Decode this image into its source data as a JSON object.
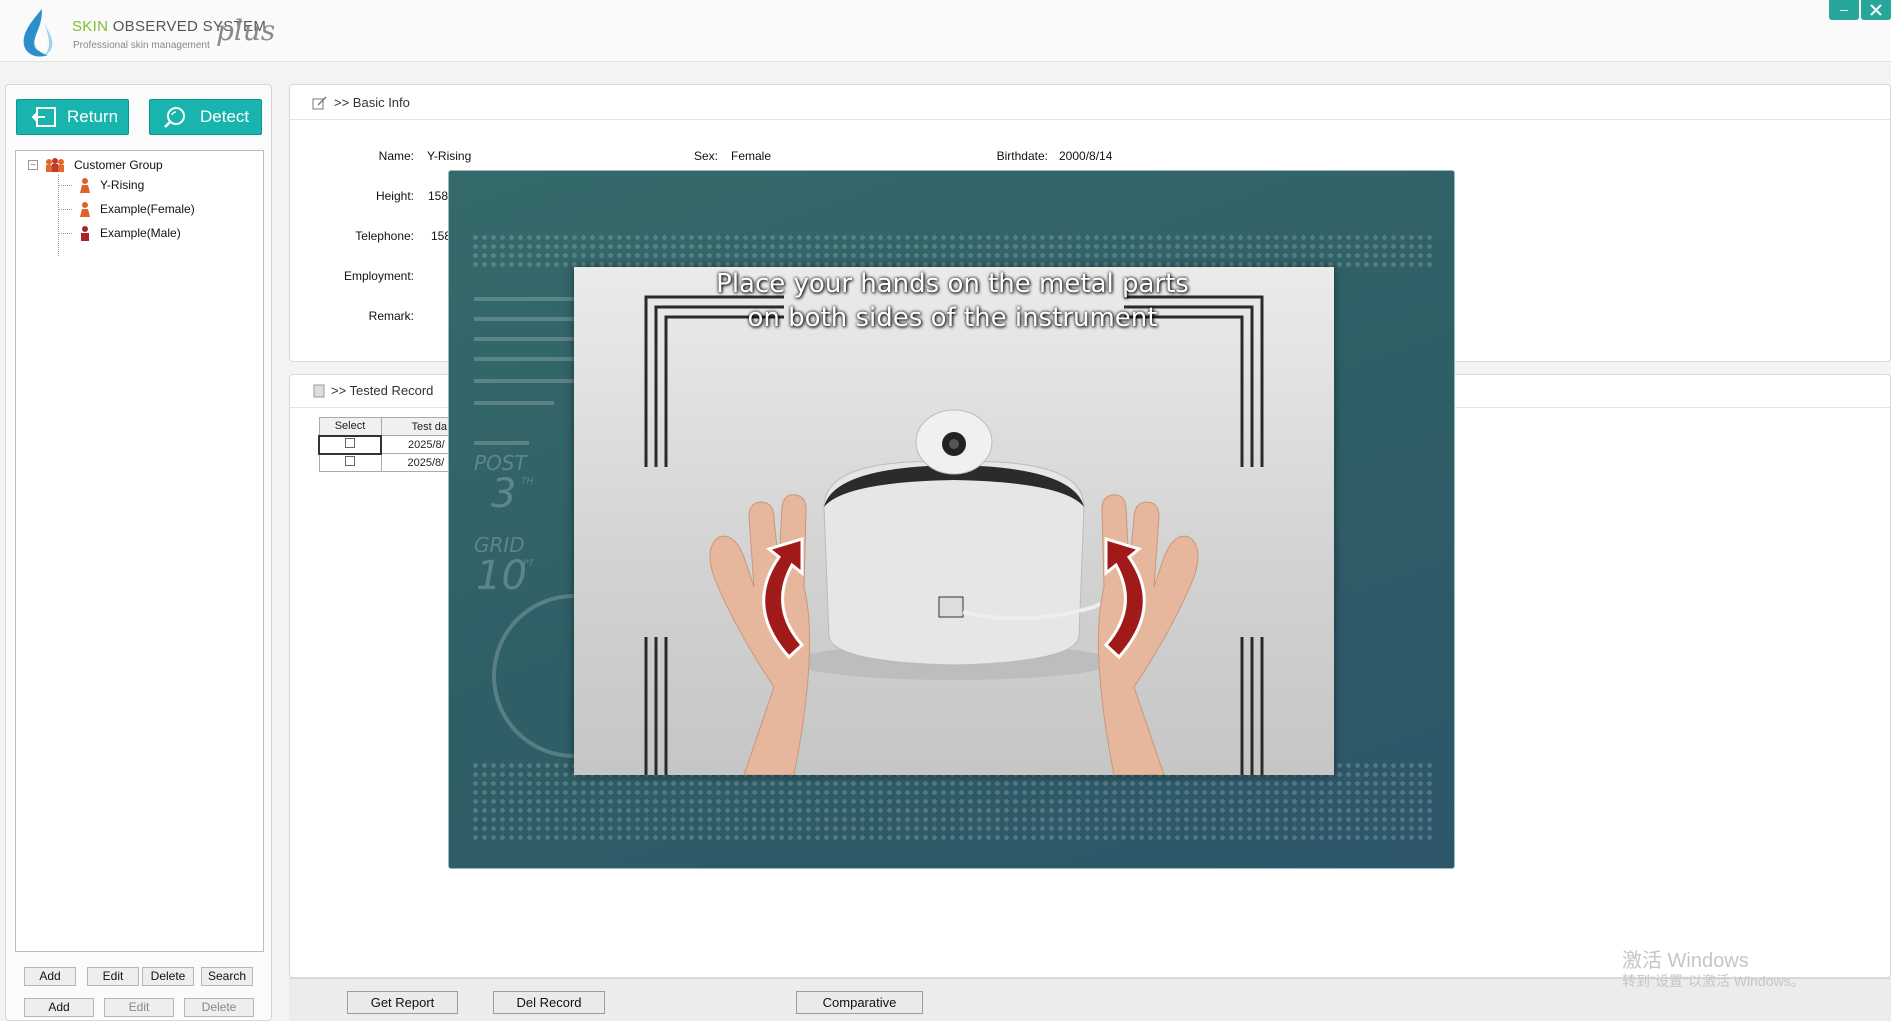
{
  "header": {
    "brand_skin": "SKIN",
    "brand_rest": "OBSERVED SYSTEM",
    "brand_sub": "Professional skin management",
    "brand_plus": "plus",
    "minimize": "–"
  },
  "sidebar": {
    "return_label": "Return",
    "detect_label": "Detect",
    "tree": {
      "group": "Customer Group",
      "customers": [
        "Y-Rising",
        "Example(Female)",
        "Example(Male)"
      ]
    },
    "row1_buttons": [
      "Add",
      "Edit",
      "Delete",
      "Search"
    ],
    "row2_buttons": [
      "Add",
      "Edit",
      "Delete"
    ]
  },
  "basic_info": {
    "title": ">> Basic Info",
    "name_label": "Name:",
    "name": "Y-Rising",
    "sex_label": "Sex:",
    "sex": "Female",
    "birthdate_label": "Birthdate:",
    "birthdate": "2000/8/14",
    "height_label": "Height:",
    "height": "158",
    "telephone_label": "Telephone:",
    "telephone": "158",
    "employment_label": "Employment:",
    "remark_label": "Remark:"
  },
  "tested_record": {
    "title": ">> Tested Record",
    "columns": [
      "Select",
      "Test da"
    ],
    "rows": [
      {
        "date": "2025/8/"
      },
      {
        "date": "2025/8/"
      }
    ]
  },
  "bottom_bar": {
    "get_report": "Get Report",
    "del_record": "Del Record",
    "comparative": "Comparative"
  },
  "overlay": {
    "line1": "Place your hands on the metal parts",
    "line2": "on both sides of the instrument",
    "hud_post": "POST",
    "hud_post_num": "3",
    "hud_post_unit": "TH",
    "hud_grid": "GRID",
    "hud_grid_num": "10",
    "hud_grid_unit": "PT"
  },
  "watermark": {
    "line1": "激活 Windows",
    "line2": "转到\"设置\"以激活 Windows。"
  }
}
